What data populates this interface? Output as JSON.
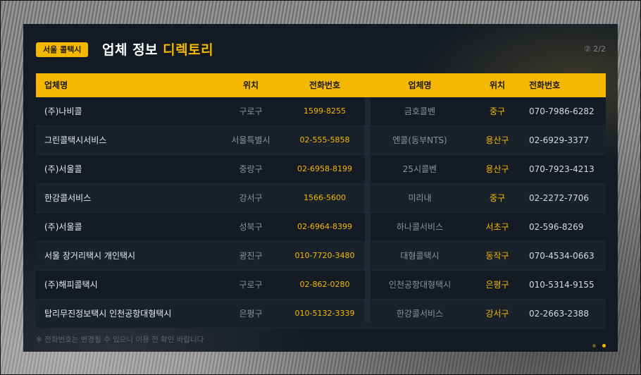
{
  "card": {
    "badge": "서울 콜택시",
    "title": "업체 정보",
    "title_accent": "디렉토리",
    "page_indicator": "② 2/2",
    "note": "※ 전화번호는 변경될 수 있으니 이용 전 확인 바랍니다"
  },
  "columns": [
    "업체명",
    "위치",
    "전화번호",
    "업체명",
    "위치",
    "전화번호"
  ],
  "rows": [
    {
      "name1": "(주)나비콜",
      "loc1": "구로구",
      "tel1": "1599-8255",
      "name2": "금호콜벤",
      "loc2": "중구",
      "tel2": "070-7986-6282"
    },
    {
      "name1": "그린콜택시서비스",
      "loc1": "서울특별시",
      "tel1": "02-555-5858",
      "name2": "엔콜(동부NTS)",
      "loc2": "용산구",
      "tel2": "02-6929-3377"
    },
    {
      "name1": "(주)서울콜",
      "loc1": "중랑구",
      "tel1": "02-6958-8199",
      "name2": "25시콜벤",
      "loc2": "용산구",
      "tel2": "070-7923-4213"
    },
    {
      "name1": "한강콜서비스",
      "loc1": "강서구",
      "tel1": "1566-5600",
      "name2": "미리내",
      "loc2": "중구",
      "tel2": "02-2272-7706"
    },
    {
      "name1": "(주)서울콜",
      "loc1": "성북구",
      "tel1": "02-6964-8399",
      "name2": "하나콜서비스",
      "loc2": "서초구",
      "tel2": "02-596-8269"
    },
    {
      "name1": "서울 장거리택시 개인택시",
      "loc1": "광진구",
      "tel1": "010-7720-3480",
      "name2": "대형콜택시",
      "loc2": "동작구",
      "tel2": "070-4534-0663"
    },
    {
      "name1": "(주)해피콜택시",
      "loc1": "구로구",
      "tel1": "02-862-0280",
      "name2": "인천공항대형택시",
      "loc2": "은평구",
      "tel2": "010-5314-9155"
    },
    {
      "name1": "탑리무진정보택시 인천공항대형택시",
      "loc1": "은평구",
      "tel1": "010-5132-3339",
      "name2": "한강콜서비스",
      "loc2": "강서구",
      "tel2": "02-2663-2388"
    }
  ],
  "pagination": {
    "total": 2,
    "current": 2
  },
  "colors": {
    "accent": "#f5b800",
    "card_bg": "#131a23"
  }
}
